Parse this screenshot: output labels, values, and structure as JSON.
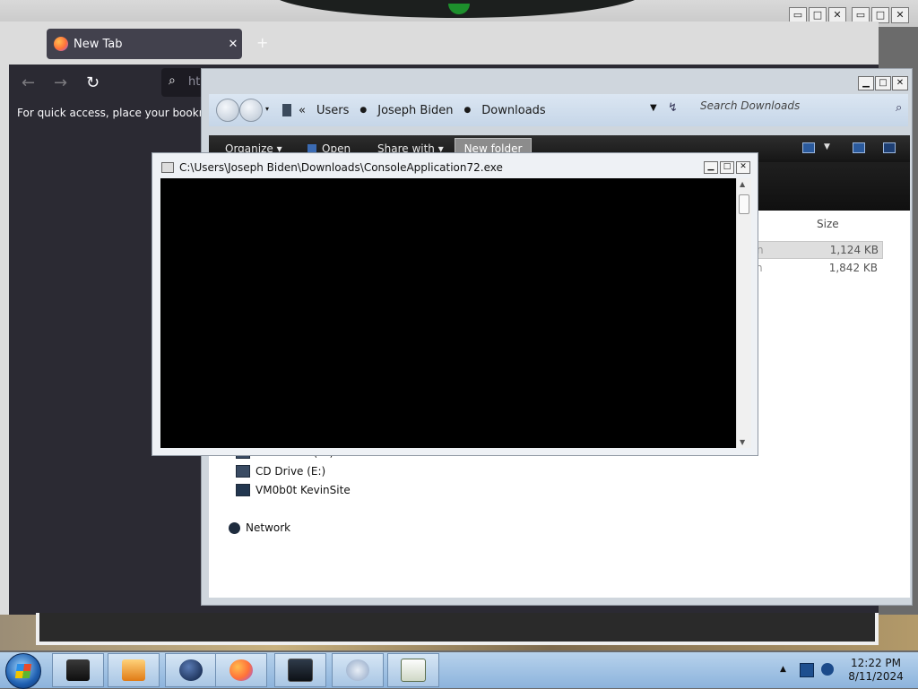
{
  "firefox": {
    "tab_title": "New Tab",
    "tab_close": "✕",
    "new_tab": "+",
    "back": "←",
    "forward": "→",
    "reload": "↻",
    "url_partial": "ht",
    "bookmark_hint": "For quick access, place your bookmark"
  },
  "explorer": {
    "breadcrumbs": [
      "Users",
      "Joseph Biden",
      "Downloads"
    ],
    "search_placeholder": "Search Downloads",
    "toolbar": {
      "organize": "Organize ▾",
      "open": "Open",
      "share_with": "Share with ▾",
      "new_folder": "New folder"
    },
    "columns": {
      "size": "Size"
    },
    "files": [
      {
        "type_partial": "n",
        "size": "1,124 KB",
        "selected": true
      },
      {
        "type_partial": "n",
        "size": "1,842 KB",
        "selected": false
      }
    ],
    "nav_items": [
      {
        "label": "Local Disk (D:)",
        "icon": "drive-icon"
      },
      {
        "label": "CD Drive (E:)",
        "icon": "cd-drive-icon"
      },
      {
        "label": "VM0b0t KevinSite",
        "icon": "network-drive-icon"
      },
      {
        "label": "Network",
        "icon": "network-icon"
      }
    ]
  },
  "console": {
    "title": "C:\\Users\\Joseph Biden\\Downloads\\ConsoleApplication72.exe"
  },
  "taskbar": {
    "apps": [
      "explorer-drive",
      "media-player",
      "globe",
      "firefox",
      "console",
      "disc-app",
      "notepad"
    ],
    "time": "12:22 PM",
    "date": "8/11/2024"
  }
}
